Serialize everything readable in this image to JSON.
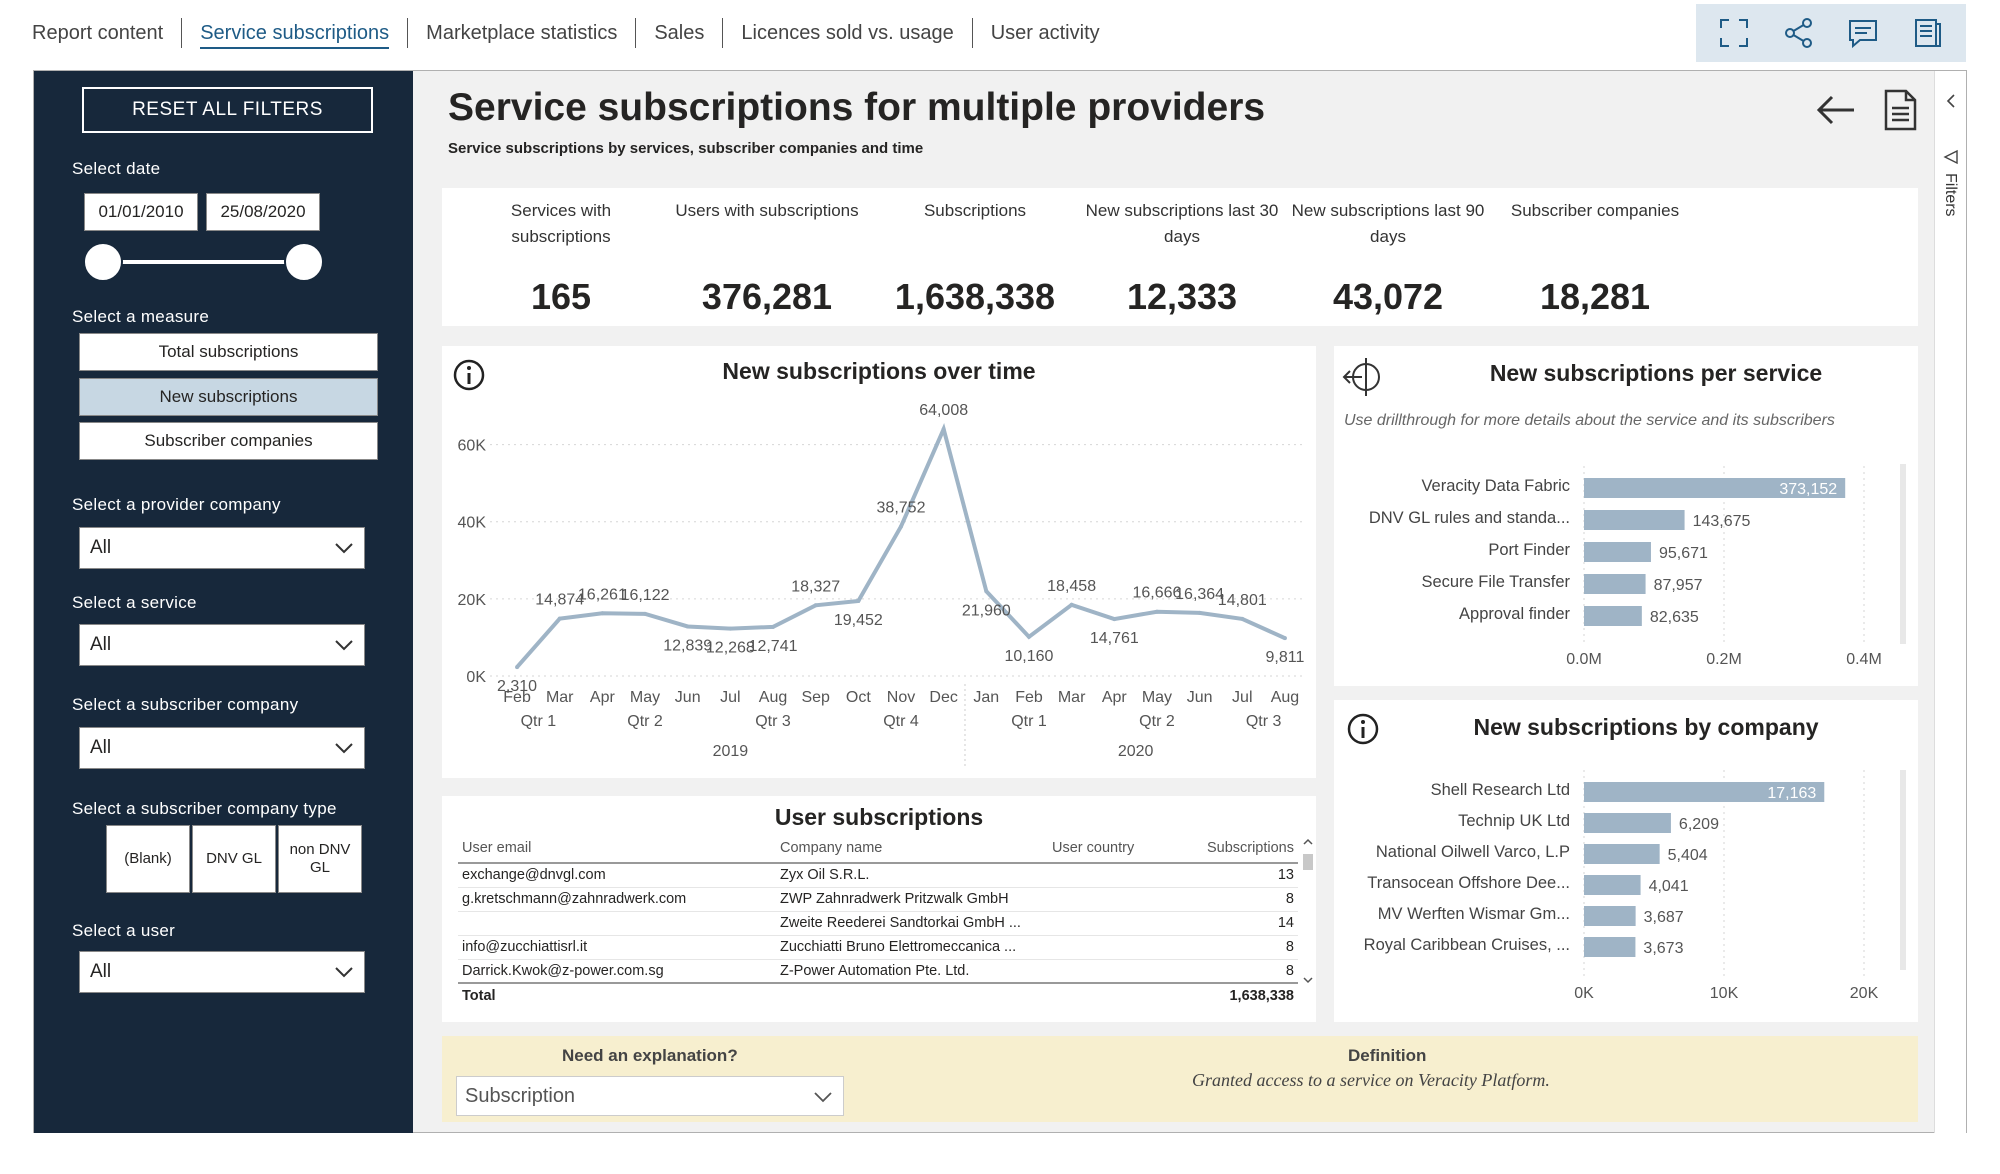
{
  "tabs": [
    {
      "label": "Report content"
    },
    {
      "label": "Service subscriptions"
    },
    {
      "label": "Marketplace statistics"
    },
    {
      "label": "Sales"
    },
    {
      "label": "Licences sold vs. usage"
    },
    {
      "label": "User activity"
    }
  ],
  "toolbar_icons": [
    "fullscreen-icon",
    "share-icon",
    "comment-icon",
    "bookmark-icon"
  ],
  "sidebar": {
    "reset_label": "RESET ALL FILTERS",
    "date_label": "Select date",
    "date_from": "01/01/2010",
    "date_to": "25/08/2020",
    "measure_label": "Select a measure",
    "measures": [
      "Total subscriptions",
      "New subscriptions",
      "Subscriber companies"
    ],
    "measure_selected": "New subscriptions",
    "provider_label": "Select a provider company",
    "provider_value": "All",
    "service_label": "Select a service",
    "service_value": "All",
    "subscriber_label": "Select a subscriber company",
    "subscriber_value": "All",
    "type_label": "Select a subscriber company type",
    "types": [
      "(Blank)",
      "DNV GL",
      "non DNV GL"
    ],
    "user_label": "Select a user",
    "user_value": "All"
  },
  "header": {
    "title": "Service subscriptions for multiple providers",
    "subtitle": "Service subscriptions by services, subscriber companies and time"
  },
  "kpis": [
    {
      "label": "Services with subscriptions",
      "value": "165"
    },
    {
      "label": "Users with subscriptions",
      "value": "376,281"
    },
    {
      "label": "Subscriptions",
      "value": "1,638,338"
    },
    {
      "label": "New subscriptions last 30 days",
      "value": "12,333"
    },
    {
      "label": "New subscriptions last 90 days",
      "value": "43,072"
    },
    {
      "label": "Subscriber companies",
      "value": "18,281"
    }
  ],
  "chart_data": [
    {
      "type": "line",
      "title": "New subscriptions over time",
      "x": [
        "Feb",
        "Mar",
        "Apr",
        "May",
        "Jun",
        "Jul",
        "Aug",
        "Sep",
        "Oct",
        "Nov",
        "Dec",
        "Jan",
        "Feb",
        "Mar",
        "Apr",
        "May",
        "Jun",
        "Jul",
        "Aug"
      ],
      "quarters": [
        {
          "label": "Qtr 1",
          "from": 0,
          "to": 1
        },
        {
          "label": "Qtr 2",
          "from": 2,
          "to": 4
        },
        {
          "label": "Qtr 3",
          "from": 5,
          "to": 7
        },
        {
          "label": "Qtr 4",
          "from": 8,
          "to": 10
        },
        {
          "label": "Qtr 1",
          "from": 11,
          "to": 13
        },
        {
          "label": "Qtr 2",
          "from": 14,
          "to": 16
        },
        {
          "label": "Qtr 3",
          "from": 17,
          "to": 18
        }
      ],
      "years": [
        {
          "label": "2019",
          "from": 0,
          "to": 10
        },
        {
          "label": "2020",
          "from": 11,
          "to": 18
        }
      ],
      "values": [
        2310,
        14874,
        16261,
        16122,
        12839,
        12268,
        12741,
        18327,
        19452,
        38752,
        64008,
        21960,
        10160,
        18458,
        14761,
        16666,
        16364,
        14801,
        9811
      ],
      "value_labels": [
        "2,310",
        "14,874",
        "16,261",
        "16,122",
        "12,839",
        "12,268",
        "12,741",
        "18,327",
        "19,452",
        "38,752",
        "64,008",
        "21,960",
        "10,160",
        "18,458",
        "14,761",
        "16,666",
        "16,364",
        "14,801",
        "9,811"
      ],
      "yticks": [
        0,
        20000,
        40000,
        60000
      ],
      "ytick_labels": [
        "0K",
        "20K",
        "40K",
        "60K"
      ],
      "ylim": [
        0,
        70000
      ],
      "color": "#9fb4c6",
      "grid": true
    },
    {
      "type": "bar",
      "orientation": "horizontal",
      "title": "New subscriptions per service",
      "subtitle": "Use drillthrough for more details about the service and its subscribers",
      "categories": [
        "Veracity Data Fabric",
        "DNV GL rules and standa...",
        "Port Finder",
        "Secure File Transfer",
        "Approval finder"
      ],
      "values": [
        373152,
        143675,
        95671,
        87957,
        82635
      ],
      "value_labels": [
        "373,152",
        "143,675",
        "95,671",
        "87,957",
        "82,635"
      ],
      "xticks": [
        0,
        200000,
        400000
      ],
      "xtick_labels": [
        "0.0M",
        "0.2M",
        "0.4M"
      ],
      "xlim": [
        0,
        400000
      ],
      "color": "#9fb4c6",
      "grid": true
    },
    {
      "type": "bar",
      "orientation": "horizontal",
      "title": "New subscriptions by company",
      "categories": [
        "Shell Research Ltd",
        "Technip UK Ltd",
        "National Oilwell Varco, L.P",
        "Transocean Offshore Dee...",
        "MV Werften Wismar Gm...",
        "Royal Caribbean Cruises, ..."
      ],
      "values": [
        17163,
        6209,
        5404,
        4041,
        3687,
        3673
      ],
      "value_labels": [
        "17,163",
        "6,209",
        "5,404",
        "4,041",
        "3,687",
        "3,673"
      ],
      "xticks": [
        0,
        10000,
        20000
      ],
      "xtick_labels": [
        "0K",
        "10K",
        "20K"
      ],
      "xlim": [
        0,
        20000
      ],
      "color": "#9fb4c6",
      "grid": true
    }
  ],
  "user_table": {
    "title": "User subscriptions",
    "columns": [
      "User email",
      "Company name",
      "User country",
      "Subscriptions"
    ],
    "rows": [
      [
        "exchange@dnvgl.com",
        "Zyx Oil S.R.L.",
        "",
        "13"
      ],
      [
        "g.kretschmann@zahnradwerk.com",
        "ZWP Zahnradwerk Pritzwalk GmbH",
        "",
        "8"
      ],
      [
        "",
        "Zweite Reederei Sandtorkai GmbH ...",
        "",
        "14"
      ],
      [
        "info@zucchiattisrl.it",
        "Zucchiatti Bruno Elettromeccanica ...",
        "",
        "8"
      ],
      [
        "Darrick.Kwok@z-power.com.sg",
        "Z-Power Automation Pte. Ltd.",
        "",
        "8"
      ]
    ],
    "total_label": "Total",
    "total_value": "1,638,338"
  },
  "explanation": {
    "label": "Need an explanation?",
    "selected": "Subscription",
    "definition_label": "Definition",
    "definition": "Granted access to a service on Veracity Platform."
  },
  "filters_pane_label": "Filters",
  "colors": {
    "sidebar_bg": "#17283b",
    "accent": "#1e5b86",
    "bar": "#9fb4c6",
    "explain_bg": "#f7efcf"
  }
}
